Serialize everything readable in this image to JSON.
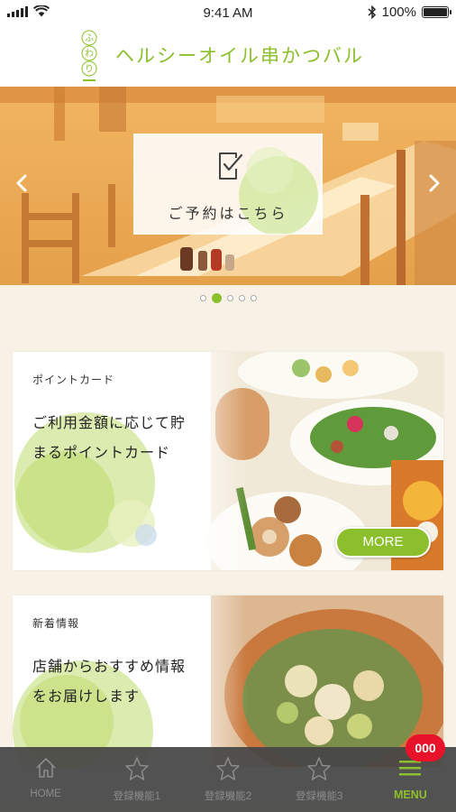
{
  "status_bar": {
    "time": "9:41 AM",
    "battery_text": "100%",
    "battery_level": 1.0
  },
  "header": {
    "title": "ヘルシーオイル串かつバル",
    "logo_text": "ふわり"
  },
  "hero": {
    "reserve_label": "ご予約はこちら",
    "slide_count": 5,
    "active_slide": 2
  },
  "cards": [
    {
      "label": "ポイントカード",
      "text_line1": "ご利用金額に応じて貯",
      "text_line2": "まるポイントカード",
      "more_label": "MORE"
    },
    {
      "label": "新着情報",
      "text_line1": "店舗からおすすめ情報",
      "text_line2": "をお届けします"
    }
  ],
  "tab_bar": {
    "tabs": [
      {
        "label": "HOME",
        "icon": "home-icon"
      },
      {
        "label": "登録機能1",
        "icon": "star-icon"
      },
      {
        "label": "登録機能2",
        "icon": "star-icon"
      },
      {
        "label": "登録機能3",
        "icon": "star-icon"
      },
      {
        "label": "MENU",
        "icon": "menu-icon"
      }
    ],
    "badge": "000"
  },
  "colors": {
    "accent": "#8cbf2c",
    "badge": "#e8132a",
    "tab_bg": "#464646"
  }
}
